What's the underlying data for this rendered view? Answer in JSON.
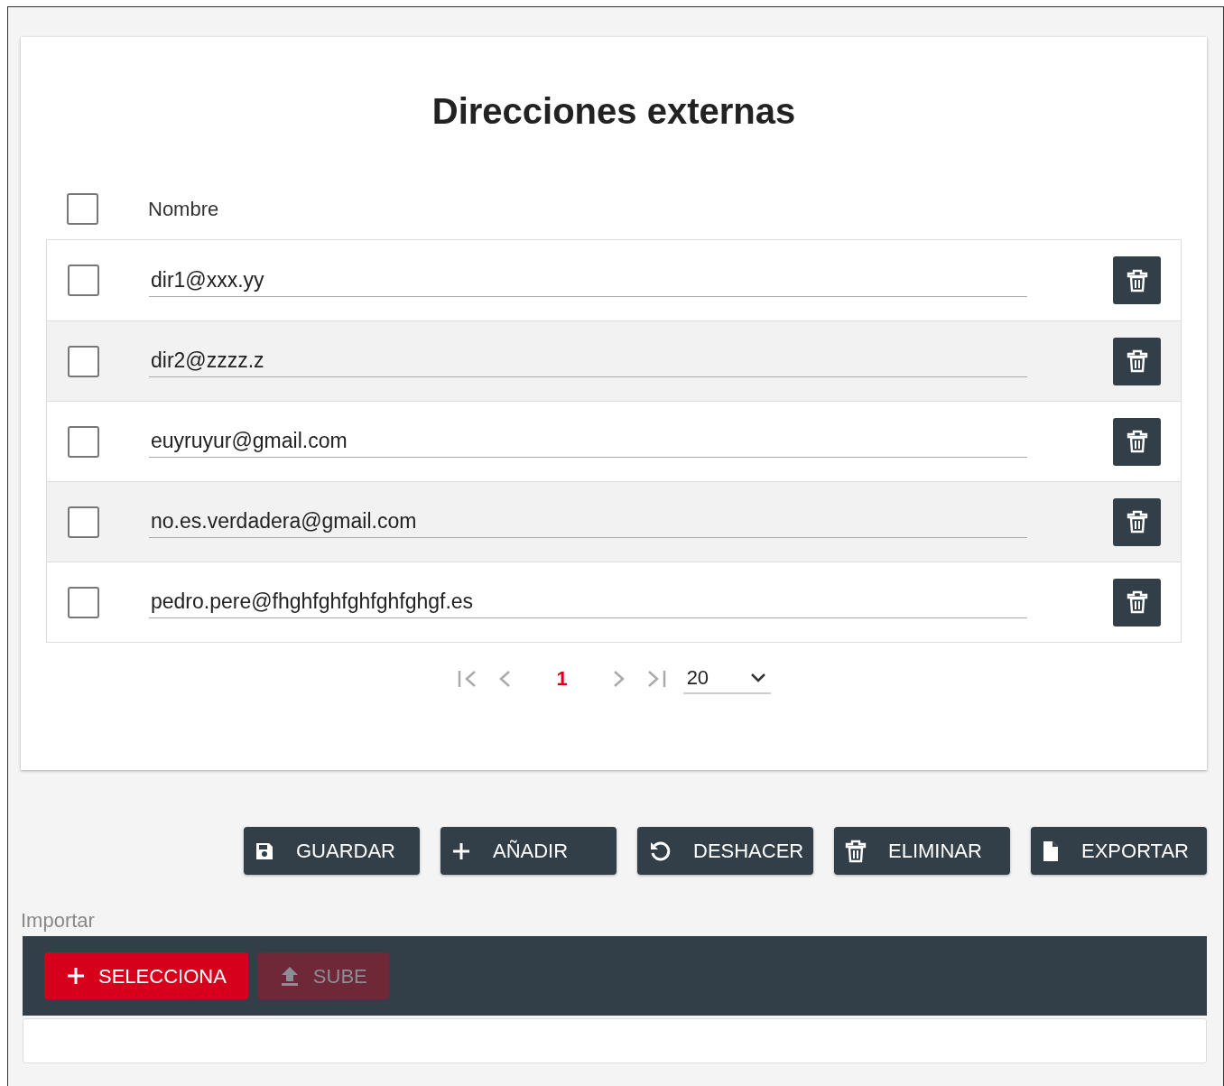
{
  "title": "Direcciones externas",
  "header": {
    "checked": false,
    "label": "Nombre"
  },
  "rows": [
    {
      "checked": false,
      "value": "dir1@xxx.yy"
    },
    {
      "checked": false,
      "value": "dir2@zzzz.z"
    },
    {
      "checked": false,
      "value": "euyruyur@gmail.com"
    },
    {
      "checked": false,
      "value": "no.es.verdadera@gmail.com"
    },
    {
      "checked": false,
      "value": "pedro.pere@fhghfghfghfghfghgf.es"
    }
  ],
  "pager": {
    "pages": [
      {
        "label": "1",
        "selected": true
      }
    ],
    "page_size": "20"
  },
  "actions": [
    {
      "kind": "save",
      "label": "GUARDAR"
    },
    {
      "kind": "add",
      "label": "AÑADIR"
    },
    {
      "kind": "undo",
      "label": "DESHACER"
    },
    {
      "kind": "delete",
      "label": "ELIMINAR"
    },
    {
      "kind": "file",
      "label": "EXPORTAR"
    }
  ],
  "import": {
    "label": "Importar",
    "buttons": [
      {
        "kind": "add",
        "label": "SELECCIONA",
        "disabled": false
      },
      {
        "kind": "upload",
        "label": "SUBE",
        "disabled": true
      }
    ]
  }
}
